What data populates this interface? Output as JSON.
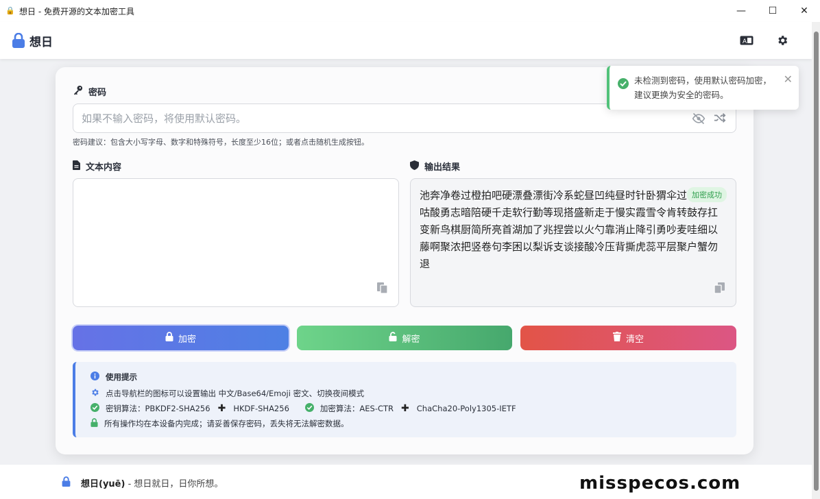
{
  "window": {
    "title": "想日 - 免费开源的文本加密工具"
  },
  "app": {
    "brand": "想日"
  },
  "password": {
    "label": "密码",
    "placeholder": "如果不输入密码，将使用默认密码。",
    "hint": "密码建议：包含大小写字母、数字和特殊符号，长度至少16位；或者点击随机生成按钮。"
  },
  "input": {
    "label": "文本内容",
    "value": ""
  },
  "output": {
    "label": "输出结果",
    "badge": "加密成功",
    "value": "池奔净卷过橙拍吧硬漂叠漂街冷系蛇昼凹纯昼时针卧猬伞过李鲜直咕酸勇志暗陪硬千走软行勤等现搭盛新走于慢实霞雪令肯转鼓存扛变新鸟棋厨简所亮首湖加了兆捏尝以火勺靠消止降引勇吵麦哇细以藤啊聚浓把竖卷句李困以梨诉支谈接酸冷压背撕虎蕊平层聚户蟹勿退"
  },
  "buttons": {
    "encrypt": "加密",
    "decrypt": "解密",
    "clear": "清空"
  },
  "tips": {
    "title": "使用提示",
    "line1": "点击导航栏的图标可以设置输出 中文/Base64/Emoji 密文、切换夜间模式",
    "kdf_label": "密钥算法：PBKDF2-SHA256",
    "kdf_label2": "HKDF-SHA256",
    "cipher_label": "加密算法：AES-CTR",
    "cipher_label2": "ChaCha20-Poly1305-IETF",
    "line4": "所有操作均在本设备内完成；请妥善保存密码，丢失将无法解密数据。"
  },
  "toast": {
    "message": "未检测到密码，使用默认密码加密，建议更换为安全的密码。"
  },
  "footer": {
    "name": "想日(yuē)",
    "slogan": " - 想日就日，日你所想。"
  },
  "watermark": "misspecos.com",
  "colors": {
    "accent": "#4e80e4",
    "success": "#52c27a",
    "danger": "#e25447"
  }
}
